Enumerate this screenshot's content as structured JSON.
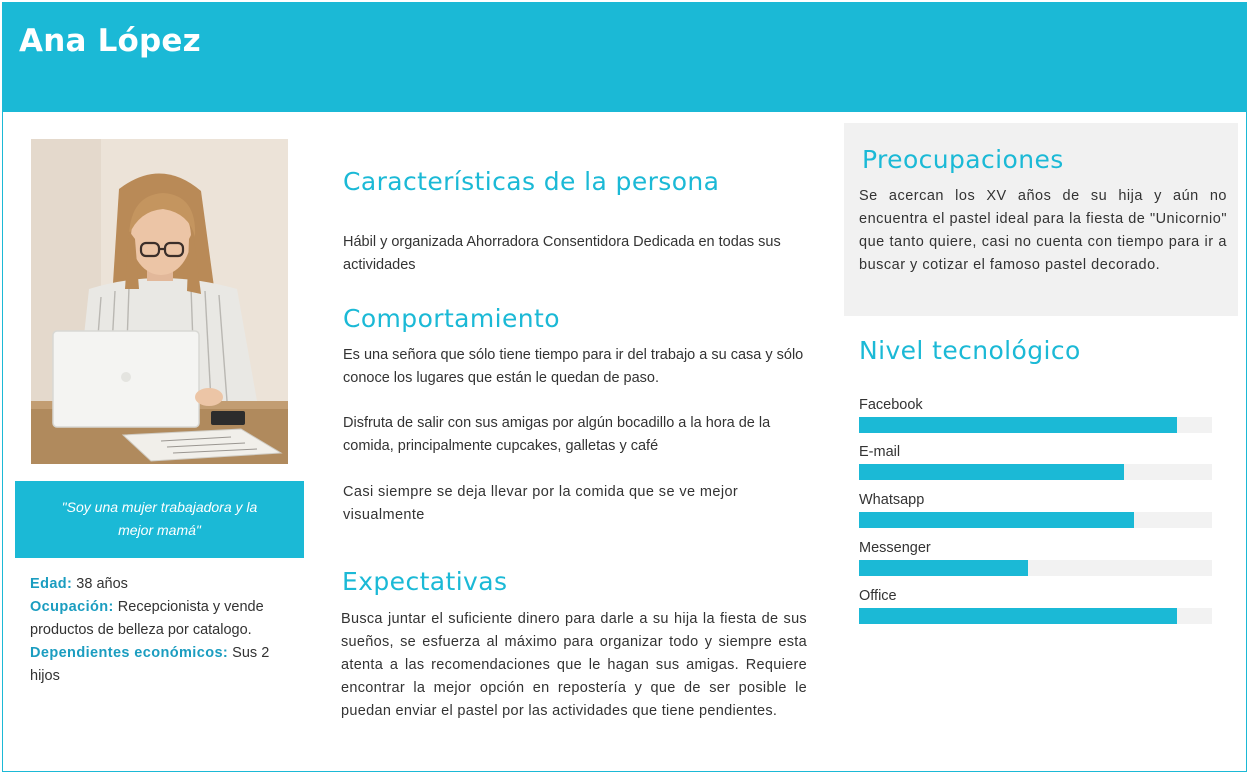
{
  "persona": {
    "name": "Ana López",
    "quote": "\"Soy una mujer trabajadora y la mejor mamá\"",
    "fields": {
      "edad_label": "Edad:",
      "edad_value": " 38 años",
      "ocupacion_label": "Ocupación:",
      "ocupacion_value": " Recepcionista y vende productos de belleza por catalogo.",
      "dependientes_label": "Dependientes económicos:",
      "dependientes_value": " Sus 2 hijos"
    }
  },
  "sections": {
    "caracteristicas": {
      "title": "Características de la persona",
      "text": "Hábil y organizada Ahorradora Consentidora Dedicada en todas sus actividades"
    },
    "comportamiento": {
      "title": "Comportamiento",
      "p1": "Es una señora que sólo tiene tiempo para ir del trabajo a su casa y sólo conoce los lugares que están le quedan de paso.",
      "p2": "Disfruta de salir con sus amigas por algún bocadillo a la hora de la comida, principalmente cupcakes, galletas y café",
      "p3": "Casi siempre se deja llevar por la comida que se ve mejor visualmente"
    },
    "expectativas": {
      "title": "Expectativas",
      "text": "Busca juntar el suficiente dinero para darle a su hija la fiesta de sus sueños, se esfuerza al máximo para organizar todo y siempre esta atenta a las recomendaciones que le hagan sus amigas. Requiere encontrar la mejor opción en repostería y que de ser posible le puedan enviar el pastel por las actividades que tiene pendientes."
    },
    "preocupaciones": {
      "title": "Preocupaciones",
      "text": "Se acercan los XV años de su hija y aún no encuentra el pastel ideal para la fiesta de \"Unicornio\" que tanto quiere, casi no cuenta con tiempo para ir a buscar y cotizar el famoso pastel decorado."
    },
    "nivel_tecnologico": {
      "title": "Nivel tecnológico",
      "items": [
        {
          "label": "Facebook",
          "level": 0.9
        },
        {
          "label": "E-mail",
          "level": 0.75
        },
        {
          "label": "Whatsapp",
          "level": 0.78
        },
        {
          "label": "Messenger",
          "level": 0.48
        },
        {
          "label": "Office",
          "level": 0.9
        }
      ]
    }
  },
  "colors": {
    "accent": "#1bb9d6",
    "label": "#1b9dc0",
    "panel": "#f1f1f1",
    "track": "#f2f2f2"
  }
}
